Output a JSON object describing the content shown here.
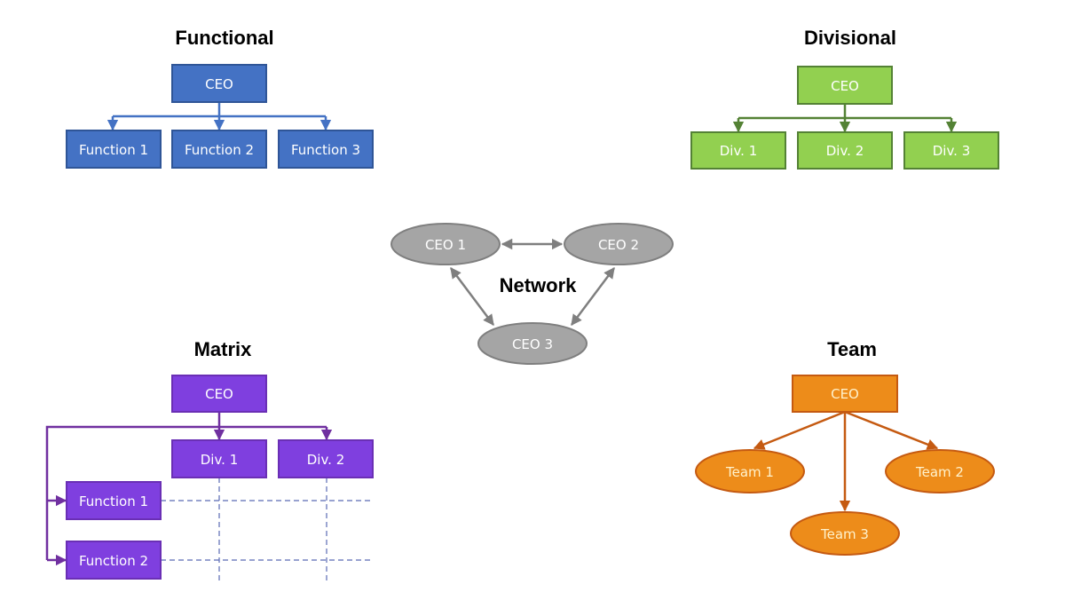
{
  "colors": {
    "functional_fill": "#4472C4",
    "functional_stroke": "#2F5597",
    "divisional_fill": "#92D050",
    "divisional_stroke": "#548235",
    "network_fill": "#A5A5A5",
    "network_stroke": "#7F7F7F",
    "matrix_fill": "#7F3FDF",
    "matrix_stroke": "#6A2FB5",
    "matrix_dash": "#5B6BB5",
    "team_fill": "#ED8C1A",
    "team_stroke": "#C55A11",
    "team_text": "#FFF2CC",
    "divisional_text": "#F0FFE0"
  },
  "functional": {
    "title": "Functional",
    "root": "CEO",
    "children": [
      "Function 1",
      "Function 2",
      "Function 3"
    ]
  },
  "divisional": {
    "title": "Divisional",
    "root": "CEO",
    "children": [
      "Div. 1",
      "Div. 2",
      "Div. 3"
    ]
  },
  "network": {
    "title": "Network",
    "nodes": [
      "CEO 1",
      "CEO 2",
      "CEO 3"
    ],
    "links": [
      [
        "CEO 1",
        "CEO 2"
      ],
      [
        "CEO 1",
        "CEO 3"
      ],
      [
        "CEO 2",
        "CEO 3"
      ]
    ],
    "link_type": "bidirectional"
  },
  "matrix": {
    "title": "Matrix",
    "root": "CEO",
    "divisions": [
      "Div. 1",
      "Div. 2"
    ],
    "functions": [
      "Function 1",
      "Function 2"
    ]
  },
  "team": {
    "title": "Team",
    "root": "CEO",
    "teams": [
      "Team 1",
      "Team 2",
      "Team 3"
    ]
  }
}
